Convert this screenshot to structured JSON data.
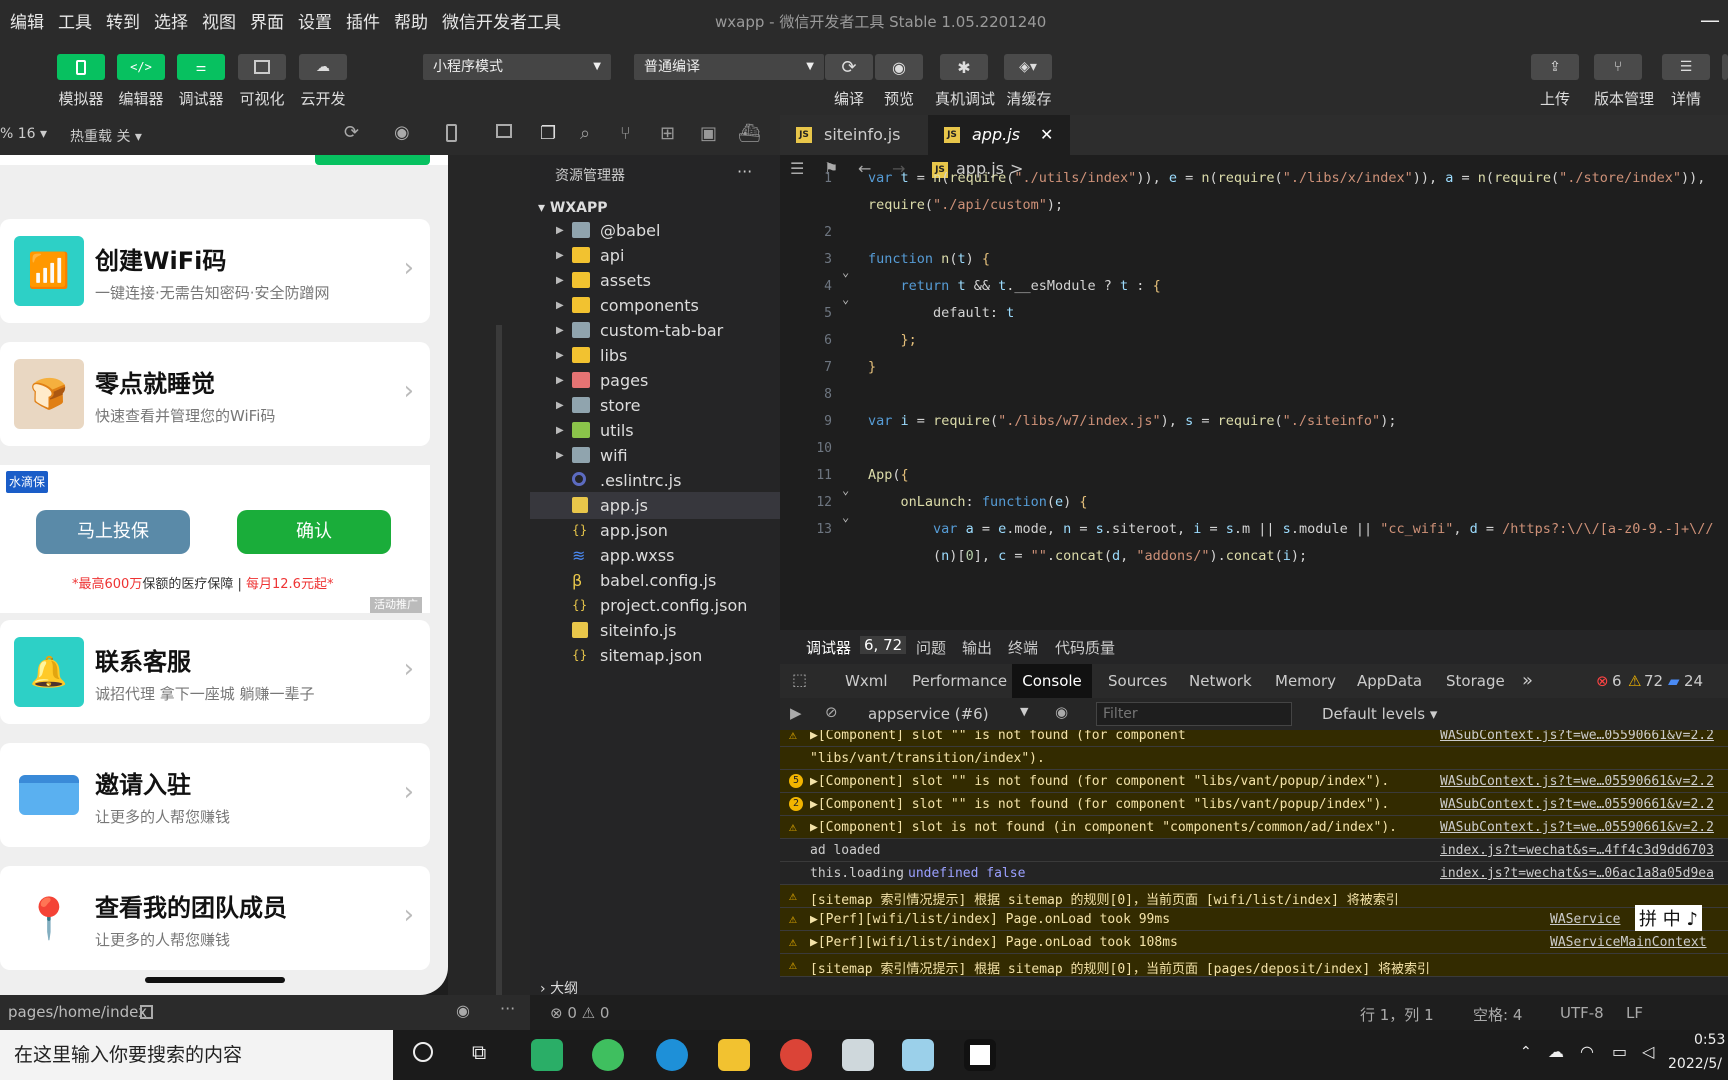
{
  "menu": [
    "编辑",
    "工具",
    "转到",
    "选择",
    "视图",
    "界面",
    "设置",
    "插件",
    "帮助",
    "微信开发者工具"
  ],
  "window_title": "wxapp - 微信开发者工具 Stable 1.05.2201240",
  "toolbar": {
    "simulator": "模拟器",
    "editor": "编辑器",
    "debugger": "调试器",
    "visual": "可视化",
    "cloud": "云开发",
    "mode_select": "小程序模式",
    "compile_select": "普通编译",
    "compile": "编译",
    "preview": "预览",
    "remote_debug": "真机调试",
    "clear_cache": "清缓存",
    "upload": "上传",
    "version": "版本管理",
    "detail": "详情"
  },
  "simulator": {
    "zoom": "% 16 ▾",
    "hotreload": "热重载 关 ▾",
    "cards": [
      {
        "title": "创建WiFi码",
        "subtitle": "一键连接·无需告知密码·安全防蹭网"
      },
      {
        "title": "零点就睡觉",
        "subtitle": "快速查看并管理您的WiFi码"
      },
      {
        "title": "联系客服",
        "subtitle": "诚招代理 拿下一座城 躺赚一辈子"
      },
      {
        "title": "邀请入驻",
        "subtitle": "让更多的人帮您赚钱"
      },
      {
        "title": "查看我的团队成员",
        "subtitle": "让更多的人帮您赚钱"
      }
    ],
    "ad": {
      "badge": "水滴保",
      "btn_left": "马上投保",
      "btn_right": "确认",
      "text_pre": "*最高",
      "text_amount": "600万",
      "text_mid": "保额的医疗保障 | ",
      "text_price": "每月12.6元起*",
      "tag": "活动推广"
    },
    "path": "pages/home/index"
  },
  "explorer": {
    "title": "资源管理器",
    "more": "···",
    "root": "WXAPP",
    "items": [
      {
        "name": "@babel",
        "type": "folder"
      },
      {
        "name": "api",
        "type": "folder-y"
      },
      {
        "name": "assets",
        "type": "folder-y"
      },
      {
        "name": "components",
        "type": "folder-y"
      },
      {
        "name": "custom-tab-bar",
        "type": "folder"
      },
      {
        "name": "libs",
        "type": "folder-y"
      },
      {
        "name": "pages",
        "type": "folder-r"
      },
      {
        "name": "store",
        "type": "folder"
      },
      {
        "name": "utils",
        "type": "folder-g"
      },
      {
        "name": "wifi",
        "type": "folder"
      },
      {
        "name": ".eslintrc.js",
        "type": "eslint"
      },
      {
        "name": "app.js",
        "type": "js"
      },
      {
        "name": "app.json",
        "type": "json"
      },
      {
        "name": "app.wxss",
        "type": "wxss"
      },
      {
        "name": "babel.config.js",
        "type": "babel"
      },
      {
        "name": "project.config.json",
        "type": "json"
      },
      {
        "name": "siteinfo.js",
        "type": "js"
      },
      {
        "name": "sitemap.json",
        "type": "json"
      }
    ],
    "outline": "大纲",
    "problems": "⊗ 0 ⚠ 0"
  },
  "editor": {
    "tabs": [
      "siteinfo.js",
      "app.js"
    ],
    "breadcrumb": "app.js",
    "breadcrumb_more": ">",
    "lines": [
      "1",
      "",
      "2",
      "3",
      "4",
      "5",
      "6",
      "7",
      "8",
      "9",
      "10",
      "11",
      "12",
      "13",
      ""
    ]
  },
  "devtools": {
    "top_tabs": [
      "调试器",
      "6, 72",
      "问题",
      "输出",
      "终端",
      "代码质量"
    ],
    "tabs": [
      "Wxml",
      "Performance",
      "Console",
      "Sources",
      "Network",
      "Memory",
      "AppData",
      "Storage"
    ],
    "tabs_more": "»",
    "errors": "6",
    "warnings": "72",
    "infos": "24",
    "context": "appservice (#6)",
    "filter_placeholder": "Filter",
    "levels": "Default levels ▾",
    "console_rows": [
      {
        "kind": "warn",
        "msg": "▶[Component] slot \"\" is not found (for component",
        "src": "WASubContext.js?t=we…05590661&v=2.2"
      },
      {
        "kind": "warn-cont",
        "msg": "\"libs/vant/transition/index\").",
        "src": ""
      },
      {
        "kind": "warn",
        "count": "5",
        "msg": "▶[Component] slot \"\" is not found (for component \"libs/vant/popup/index\").",
        "src": "WASubContext.js?t=we…05590661&v=2.2"
      },
      {
        "kind": "warn",
        "count": "2",
        "msg": "▶[Component] slot \"\" is not found (for component \"libs/vant/popup/index\").",
        "src": "WASubContext.js?t=we…05590661&v=2.2"
      },
      {
        "kind": "warn",
        "msg": "▶[Component] slot is not found (in component \"components/common/ad/index\").",
        "src": "WASubContext.js?t=we…05590661&v=2.2"
      },
      {
        "kind": "log",
        "msg": "ad loaded",
        "src": "index.js?t=wechat&s=…4ff4c3d9dd6703"
      },
      {
        "kind": "log",
        "msg": "this.loading",
        "extra": "undefined false",
        "src": "index.js?t=wechat&s=…06ac1a8a05d9ea"
      },
      {
        "kind": "warn",
        "msg": "[sitemap 索引情况提示] 根据 sitemap 的规则[0]，当前页面 [wifi/list/index] 将被索引",
        "src": ""
      },
      {
        "kind": "warn",
        "msg": "▶[Perf][wifi/list/index] Page.onLoad took 99ms",
        "src": "WAService"
      },
      {
        "kind": "warn",
        "msg": "▶[Perf][wifi/list/index] Page.onLoad took 108ms",
        "src": "WAServiceMainContext"
      },
      {
        "kind": "warn",
        "msg": "[sitemap 索引情况提示] 根据 sitemap 的规则[0]，当前页面 [pages/deposit/index] 将被索引",
        "src": ""
      }
    ]
  },
  "status": {
    "pos": "行 1，列 1",
    "spaces": "空格: 4",
    "enc": "UTF-8",
    "eol": "LF"
  },
  "ime": "拼 中 ♪",
  "taskbar": {
    "search": "在这里输入你要搜索的内容",
    "time": "0:53",
    "date": "2022/5/"
  },
  "colors": {
    "accent_green": "#07c160",
    "tab_active_bg": "#1e1e1e",
    "warn_bg": "#332b00"
  }
}
